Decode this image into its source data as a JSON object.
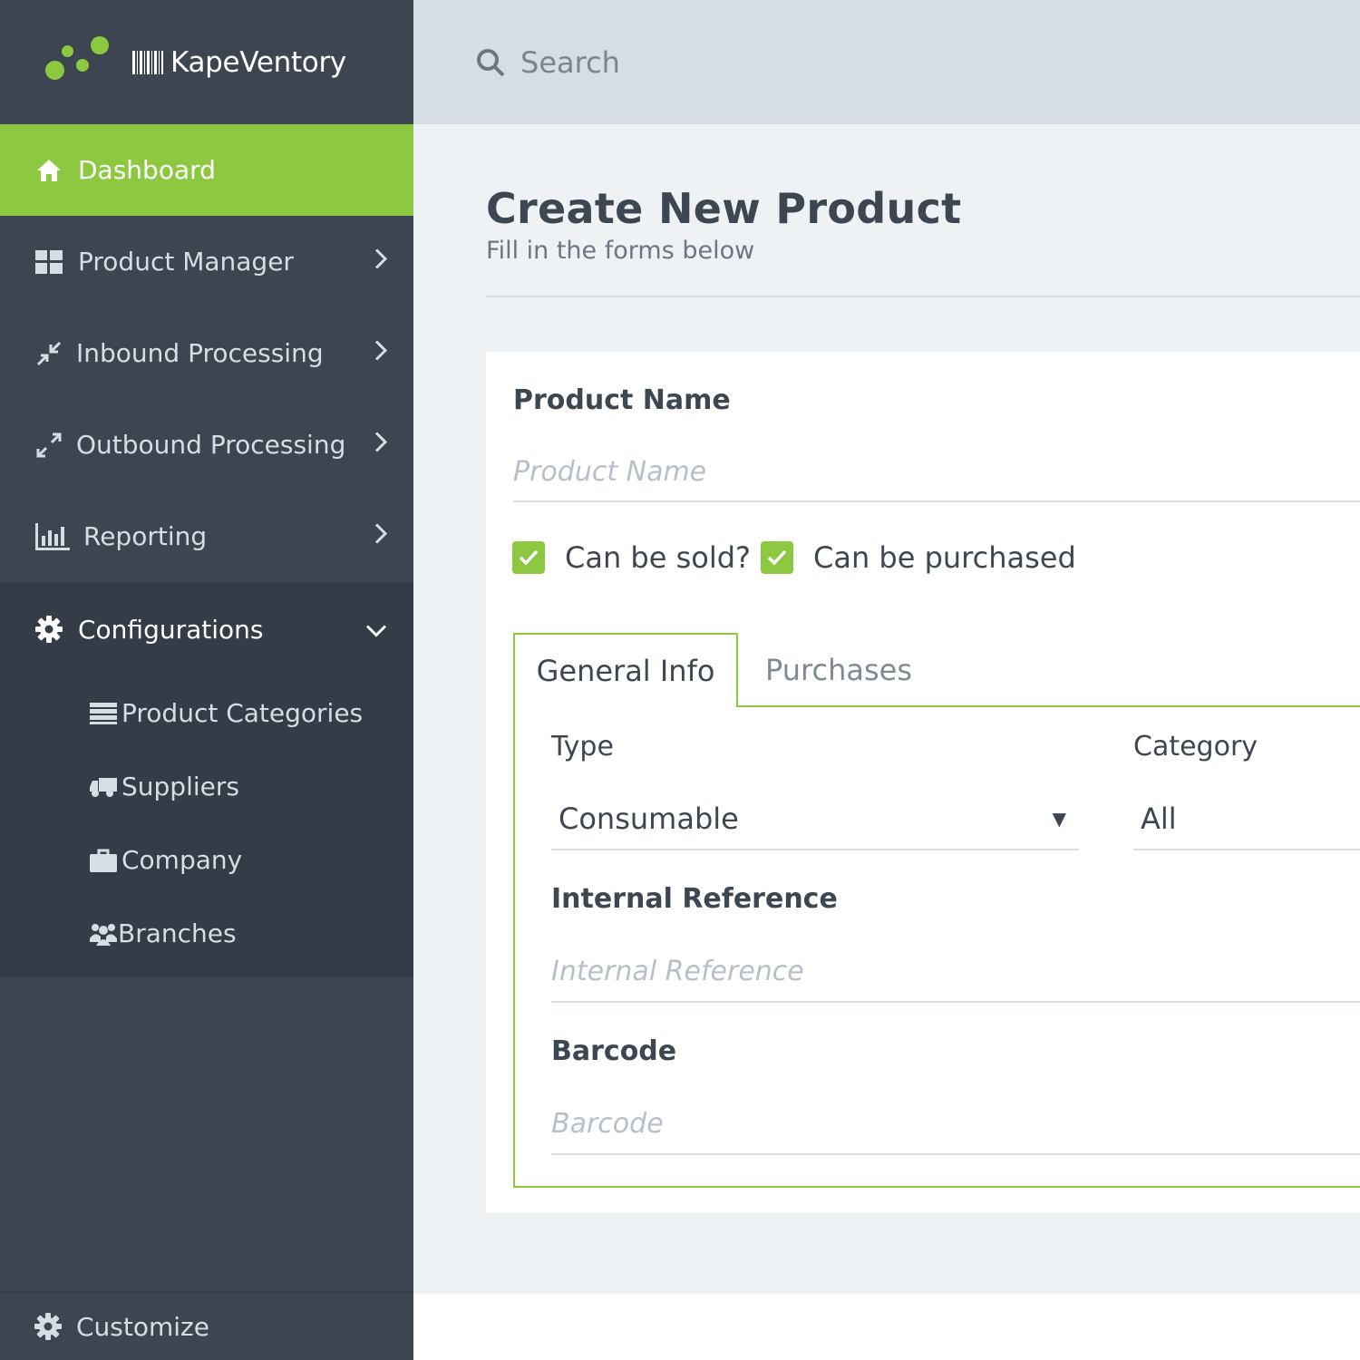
{
  "brand": {
    "name": "KapeVentory"
  },
  "colors": {
    "accent": "#8cc940",
    "sidebar": "#3c4550",
    "topbar": "#d6dde4",
    "content_bg": "#eff2f5"
  },
  "sidebar": {
    "items": [
      {
        "label": "Dashboard",
        "icon": "home-icon",
        "active": true
      },
      {
        "label": "Product Manager",
        "icon": "grid-icon"
      },
      {
        "label": "Inbound Processing",
        "icon": "compress-arrows-icon"
      },
      {
        "label": "Outbound Processing",
        "icon": "expand-arrows-icon"
      },
      {
        "label": "Reporting",
        "icon": "bar-chart-icon"
      }
    ],
    "configurations": {
      "label": "Configurations",
      "icon": "gear-icon",
      "expanded": true,
      "children": [
        {
          "label": "Product Categories",
          "icon": "list-icon"
        },
        {
          "label": "Suppliers",
          "icon": "truck-icon"
        },
        {
          "label": "Company",
          "icon": "briefcase-icon"
        },
        {
          "label": "Branches",
          "icon": "users-icon"
        }
      ]
    },
    "bottom": {
      "label": "Customize",
      "icon": "gear-icon"
    }
  },
  "topbar": {
    "search_placeholder": "Search"
  },
  "page": {
    "title": "Create New Product",
    "subtitle": "Fill in the forms below"
  },
  "form": {
    "product_name": {
      "label": "Product Name",
      "placeholder": "Product Name",
      "value": ""
    },
    "can_be_sold": {
      "label": "Can be sold?",
      "checked": true
    },
    "can_be_purchased": {
      "label": "Can be purchased",
      "checked": true
    },
    "tabs": [
      {
        "label": "General Info",
        "active": true
      },
      {
        "label": "Purchases",
        "active": false
      }
    ],
    "type": {
      "label": "Type",
      "value": "Consumable"
    },
    "category": {
      "label": "Category",
      "value": "All"
    },
    "internal_reference": {
      "label": "Internal Reference",
      "placeholder": "Internal Reference",
      "value": ""
    },
    "barcode": {
      "label": "Barcode",
      "placeholder": "Barcode",
      "value": ""
    }
  }
}
